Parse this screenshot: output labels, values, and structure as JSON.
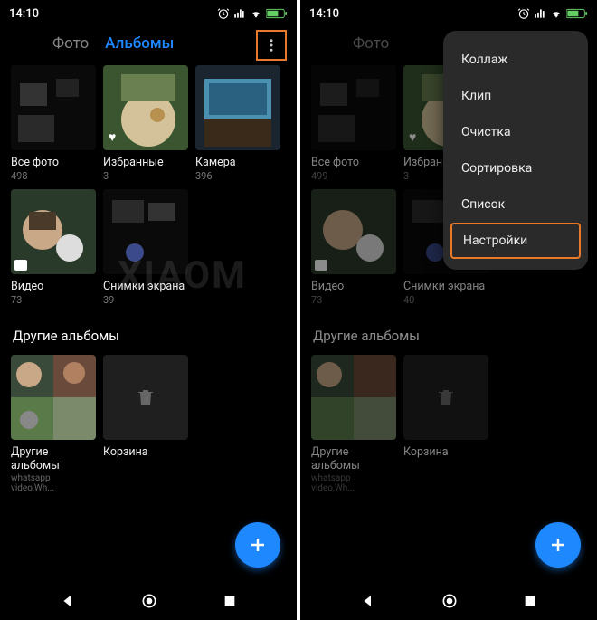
{
  "left": {
    "status": {
      "time": "14:10"
    },
    "tabs": {
      "photos": "Фото",
      "albums": "Альбомы"
    },
    "albums": [
      {
        "title": "Все фото",
        "count": "498"
      },
      {
        "title": "Избранные",
        "count": "3"
      },
      {
        "title": "Камера",
        "count": "396"
      },
      {
        "title": "Видео",
        "count": "73"
      },
      {
        "title": "Снимки экрана",
        "count": "39"
      }
    ],
    "section": "Другие альбомы",
    "other": [
      {
        "title": "Другие альбомы",
        "sub": "whatsapp video,Wh..."
      },
      {
        "title": "Корзина"
      }
    ]
  },
  "right": {
    "status": {
      "time": "14:10"
    },
    "tabs": {
      "photos": "Фото"
    },
    "albums": [
      {
        "title": "Все фото",
        "count": "499"
      },
      {
        "title": "Избранные",
        "count": "3"
      },
      {
        "title": "Видео",
        "count": "73"
      },
      {
        "title": "Снимки экрана",
        "count": "40"
      }
    ],
    "section": "Другие альбомы",
    "other": [
      {
        "title": "Другие альбомы",
        "sub": "whatsapp video,Wh..."
      },
      {
        "title": "Корзина"
      }
    ],
    "menu": [
      "Коллаж",
      "Клип",
      "Очистка",
      "Сортировка",
      "Список",
      "Настройки"
    ]
  },
  "watermark": "XIAOM"
}
